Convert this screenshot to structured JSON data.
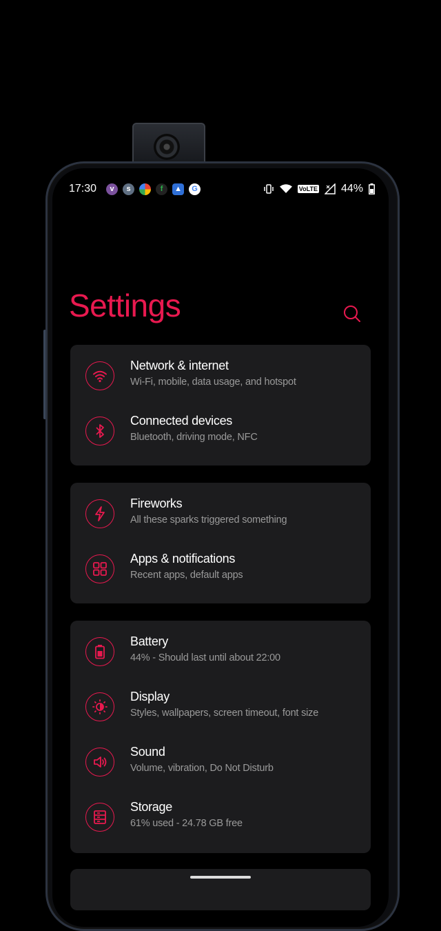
{
  "status_bar": {
    "time": "17:30",
    "battery": "44%",
    "network_badge": "VoLTE",
    "notification_icons": [
      "viber-icon",
      "steam-icon",
      "photos-icon",
      "feedly-icon",
      "gallery-icon",
      "google-icon"
    ]
  },
  "page": {
    "title": "Settings"
  },
  "colors": {
    "accent": "#e8194f",
    "card": "#1c1c1e",
    "background": "#000000",
    "subtitle": "#9a9a9a"
  },
  "groups": [
    {
      "items": [
        {
          "icon": "wifi-icon",
          "title": "Network & internet",
          "subtitle": "Wi-Fi, mobile, data usage, and hotspot"
        },
        {
          "icon": "bluetooth-icon",
          "title": "Connected devices",
          "subtitle": "Bluetooth, driving mode, NFC"
        }
      ]
    },
    {
      "items": [
        {
          "icon": "lightning-icon",
          "title": "Fireworks",
          "subtitle": "All these sparks triggered something"
        },
        {
          "icon": "apps-grid-icon",
          "title": "Apps & notifications",
          "subtitle": "Recent apps, default apps"
        }
      ]
    },
    {
      "items": [
        {
          "icon": "battery-icon",
          "title": "Battery",
          "subtitle": "44% - Should last until about 22:00"
        },
        {
          "icon": "brightness-icon",
          "title": "Display",
          "subtitle": "Styles, wallpapers, screen timeout, font size"
        },
        {
          "icon": "speaker-icon",
          "title": "Sound",
          "subtitle": "Volume, vibration, Do Not Disturb"
        },
        {
          "icon": "storage-icon",
          "title": "Storage",
          "subtitle": "61% used - 24.78 GB free"
        }
      ]
    }
  ]
}
